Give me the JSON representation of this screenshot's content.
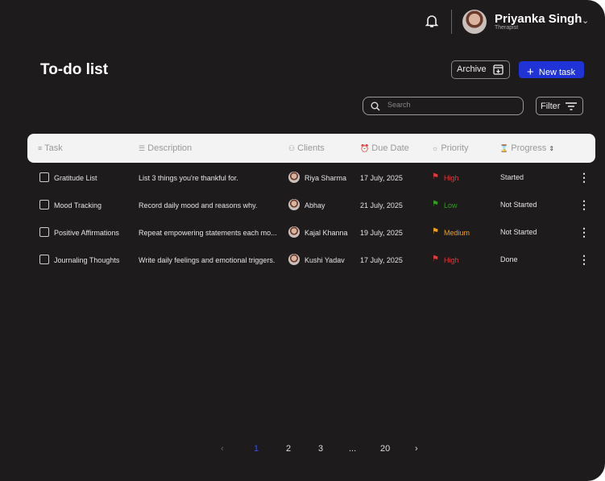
{
  "header": {
    "user_name": "Priyanka Singh",
    "user_role": "Therapist"
  },
  "page": {
    "title": "To-do list",
    "archive_label": "Archive",
    "new_task_label": "New task",
    "search_placeholder": "Search",
    "filter_label": "Filter"
  },
  "table": {
    "headers": [
      "Task",
      "Description",
      "Clients",
      "Due Date",
      "Priority",
      "Progress"
    ],
    "rows": [
      {
        "task": "Gratitude List",
        "description": "List 3 things you're thankful for.",
        "client": "Riya Sharma",
        "due": "17 July, 2025",
        "priority": "High",
        "priority_color": "#e0393e",
        "progress": "Started"
      },
      {
        "task": "Mood Tracking",
        "description": "Record daily mood and reasons why.",
        "client": "Abhay",
        "due": "21 July, 2025",
        "priority": "Low",
        "priority_color": "#2fa11f",
        "progress": "Not Started"
      },
      {
        "task": "Positive Affirmations",
        "description": "Repeat empowering statements each mo...",
        "client": "Kajal Khanna",
        "due": "19 July, 2025",
        "priority": "Medium",
        "priority_color": "#f0a019",
        "progress": "Not Started"
      },
      {
        "task": "Journaling Thoughts",
        "description": "Write daily feelings and emotional triggers.",
        "client": "Kushi Yadav",
        "due": "17 July, 2025",
        "priority": "High",
        "priority_color": "#e0393e",
        "progress": "Done"
      }
    ]
  },
  "pagination": {
    "pages": [
      "1",
      "2",
      "3",
      "...",
      "20"
    ],
    "current": "1"
  }
}
